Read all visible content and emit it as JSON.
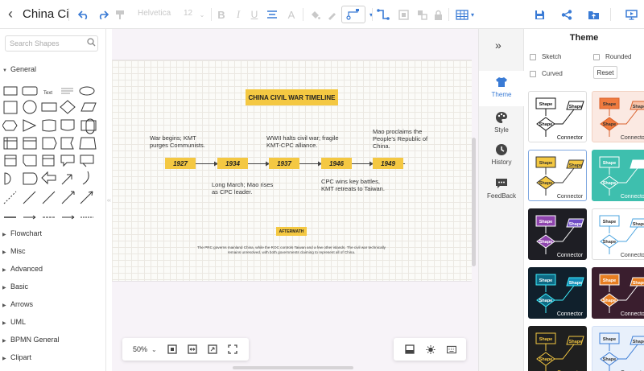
{
  "app": {
    "doc_title": "China Ci"
  },
  "toolbar": {
    "font": "Helvetica",
    "font_size": "12"
  },
  "left_panel": {
    "search_placeholder": "Search Shapes",
    "general_label": "General",
    "text_shape_label": "Text",
    "categories": [
      "Flowchart",
      "Misc",
      "Advanced",
      "Basic",
      "Arrows",
      "UML",
      "BPMN General",
      "Clipart"
    ]
  },
  "diagram": {
    "title": "CHINA CIVIL WAR TIMELINE",
    "years": [
      "1927",
      "1934",
      "1937",
      "1946",
      "1949"
    ],
    "events": {
      "e1927": "War begins; KMT purges Communists.",
      "e1934": "Long March; Mao rises as CPC leader.",
      "e1937": "WWII halts civil war; fragile KMT-CPC alliance.",
      "e1946": "CPC wins key battles, KMT retreats to Taiwan.",
      "e1949": "Mao proclaims the People's Republic of China."
    },
    "aftermath_label": "AFTERMATH",
    "aftermath_text": "The PRC governs mainland China, while the ROC controls Taiwan and a few other islands. The civil war technically remains unresolved, with both governments claiming to represent all of China."
  },
  "zoom": {
    "level": "50%"
  },
  "right_nav": {
    "items": [
      "Theme",
      "Style",
      "History",
      "FeedBack"
    ]
  },
  "theme_panel": {
    "title": "Theme",
    "options": {
      "sketch": "Sketch",
      "rounded": "Rounded",
      "curved": "Curved",
      "reset": "Reset"
    },
    "card_shape_label": "Shape",
    "card_connector_label": "Connector"
  },
  "colors": {
    "accent": "#3a7bd5",
    "diagram_yellow": "#f4c842",
    "canvas_bg": "#f7f3f8"
  }
}
